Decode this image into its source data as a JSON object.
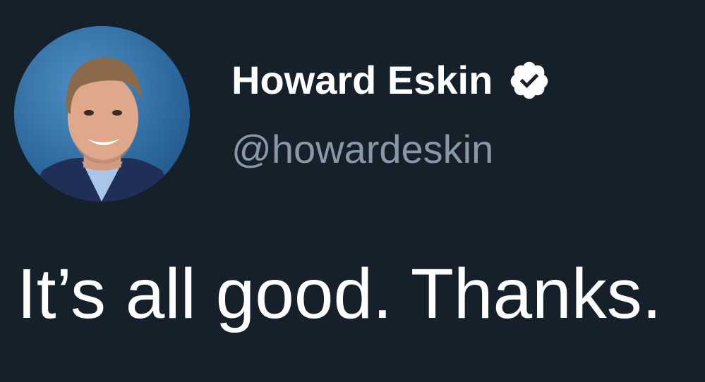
{
  "tweet": {
    "author": {
      "name": "Howard Eskin",
      "handle": "@howardeskin",
      "verified": true,
      "avatar_icon": "profile-photo"
    },
    "text": "It’s all good. Thanks."
  },
  "colors": {
    "background": "#15202b",
    "name": "#ffffff",
    "handle": "#8899a6",
    "text": "#ffffff",
    "verified_badge": "#ffffff"
  }
}
